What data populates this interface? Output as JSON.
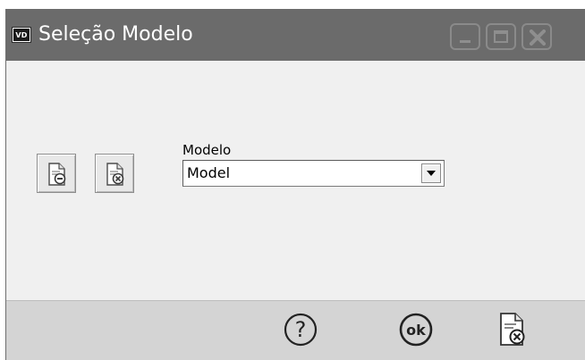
{
  "window": {
    "title": "Seleção Modelo",
    "app_icon_text": "VD"
  },
  "controls": {
    "minimize": "minimize",
    "maximize": "maximize",
    "close": "close"
  },
  "form": {
    "model_label": "Modelo",
    "model_value": "Model"
  },
  "toolbar": {
    "icons": [
      "document-go-icon",
      "document-cancel-icon"
    ]
  },
  "footer": {
    "icons": [
      "help-icon",
      "ok-icon",
      "cancel-document-icon"
    ]
  },
  "colors": {
    "titlebar": "#6b6b6b",
    "client": "#f0f0f0",
    "footer": "#d4d4d4"
  }
}
